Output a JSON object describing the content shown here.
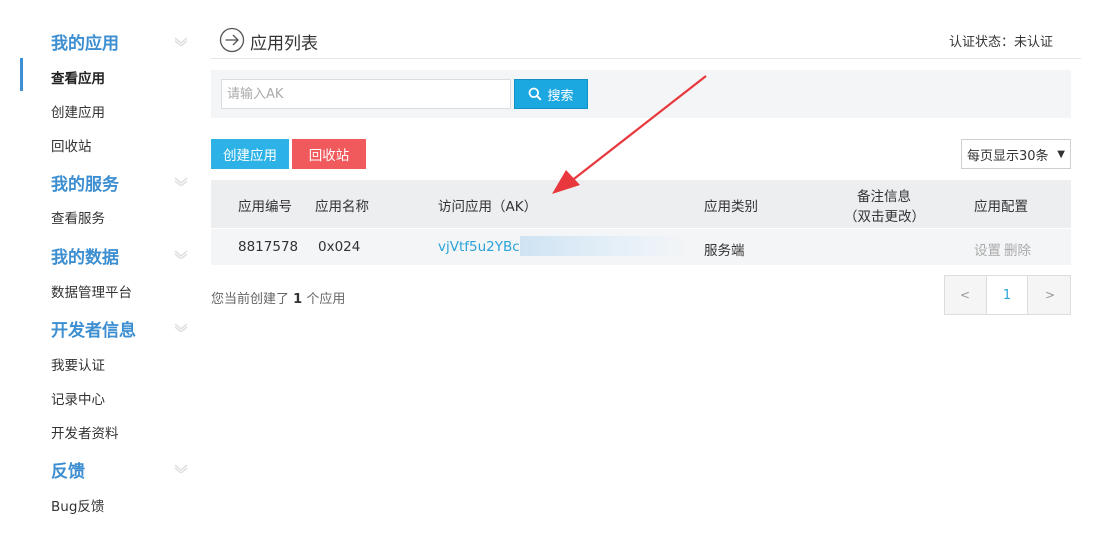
{
  "sidebar": {
    "sections": [
      {
        "title": "我的应用",
        "items": [
          "查看应用",
          "创建应用",
          "回收站"
        ]
      },
      {
        "title": "我的服务",
        "items": [
          "查看服务"
        ]
      },
      {
        "title": "我的数据",
        "items": [
          "数据管理平台"
        ]
      },
      {
        "title": "开发者信息",
        "items": [
          "我要认证",
          "记录中心",
          "开发者资料"
        ]
      },
      {
        "title": "反馈",
        "items": [
          "Bug反馈"
        ]
      }
    ],
    "active_item": "查看应用"
  },
  "header": {
    "title": "应用列表",
    "auth_label": "认证状态：",
    "auth_value": "未认证"
  },
  "search": {
    "placeholder": "请输入AK",
    "value": "",
    "button_label": "搜索"
  },
  "actions": {
    "create_label": "创建应用",
    "recycle_label": "回收站",
    "page_size_label": "每页显示30条"
  },
  "table": {
    "headers": {
      "id": "应用编号",
      "name": "应用名称",
      "ak": "访问应用（AK）",
      "type": "应用类别",
      "note_line1": "备注信息",
      "note_line2": "（双击更改）",
      "config": "应用配置"
    },
    "rows": [
      {
        "id": "8817578",
        "name": "0x024",
        "ak": "vjVtf5u2YBck",
        "type": "服务端",
        "note": "",
        "op_settings": "设置",
        "op_delete": "删除"
      }
    ]
  },
  "footer": {
    "count_prefix": "您当前创建了",
    "count": "1",
    "count_suffix": "个应用"
  },
  "pagination": {
    "prev": "<",
    "current": "1",
    "next": ">"
  },
  "colors": {
    "accent": "#3d8fd1",
    "search_button": "#1ba7e0",
    "create_button": "#2cb2e6",
    "recycle_button": "#f05a5d",
    "annotation_arrow": "#e8383d"
  }
}
